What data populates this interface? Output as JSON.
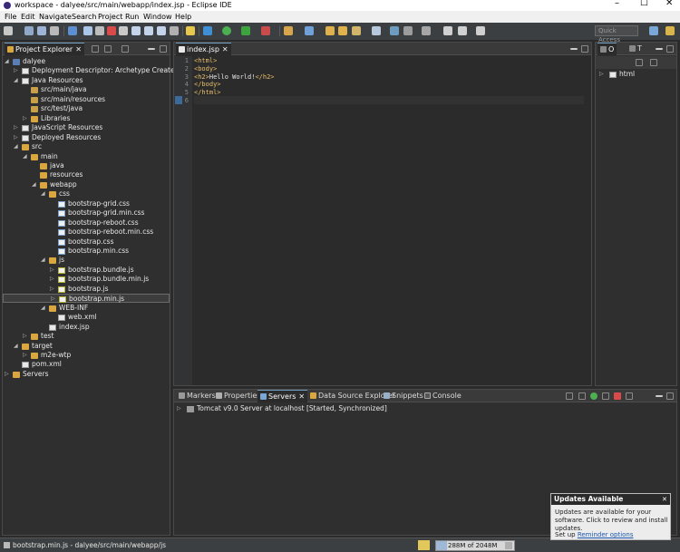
{
  "window": {
    "title": "workspace - dalyee/src/main/webapp/index.jsp - Eclipse IDE",
    "minimize": "–",
    "maximize": "☐",
    "close": "✕"
  },
  "menu": [
    "File",
    "Edit",
    "Navigate",
    "Search",
    "Project",
    "Run",
    "Window",
    "Help"
  ],
  "toolbar": {
    "quick_access_placeholder": "Quick Access"
  },
  "project_explorer": {
    "tab_label": "Project Explorer",
    "tree": [
      {
        "label": "dalyee",
        "depth": 0,
        "twisty": "open",
        "icon": "proj"
      },
      {
        "label": "Deployment Descriptor: Archetype Created Web",
        "depth": 1,
        "twisty": "closed",
        "icon": "file"
      },
      {
        "label": "Java Resources",
        "depth": 1,
        "twisty": "open",
        "icon": "file"
      },
      {
        "label": "src/main/java",
        "depth": 2,
        "twisty": "",
        "icon": "pkg"
      },
      {
        "label": "src/main/resources",
        "depth": 2,
        "twisty": "",
        "icon": "pkg"
      },
      {
        "label": "src/test/java",
        "depth": 2,
        "twisty": "",
        "icon": "pkg"
      },
      {
        "label": "Libraries",
        "depth": 2,
        "twisty": "closed",
        "icon": "folder"
      },
      {
        "label": "JavaScript Resources",
        "depth": 1,
        "twisty": "closed",
        "icon": "file"
      },
      {
        "label": "Deployed Resources",
        "depth": 1,
        "twisty": "closed",
        "icon": "file"
      },
      {
        "label": "src",
        "depth": 1,
        "twisty": "open",
        "icon": "folder"
      },
      {
        "label": "main",
        "depth": 2,
        "twisty": "open",
        "icon": "folder"
      },
      {
        "label": "java",
        "depth": 3,
        "twisty": "",
        "icon": "folder"
      },
      {
        "label": "resources",
        "depth": 3,
        "twisty": "",
        "icon": "folder"
      },
      {
        "label": "webapp",
        "depth": 3,
        "twisty": "open",
        "icon": "folder"
      },
      {
        "label": "css",
        "depth": 4,
        "twisty": "open",
        "icon": "folder"
      },
      {
        "label": "bootstrap-grid.css",
        "depth": 5,
        "twisty": "",
        "icon": "cssf"
      },
      {
        "label": "bootstrap-grid.min.css",
        "depth": 5,
        "twisty": "",
        "icon": "cssf"
      },
      {
        "label": "bootstrap-reboot.css",
        "depth": 5,
        "twisty": "",
        "icon": "cssf"
      },
      {
        "label": "bootstrap-reboot.min.css",
        "depth": 5,
        "twisty": "",
        "icon": "cssf"
      },
      {
        "label": "bootstrap.css",
        "depth": 5,
        "twisty": "",
        "icon": "cssf"
      },
      {
        "label": "bootstrap.min.css",
        "depth": 5,
        "twisty": "",
        "icon": "cssf"
      },
      {
        "label": "js",
        "depth": 4,
        "twisty": "open",
        "icon": "folder"
      },
      {
        "label": "bootstrap.bundle.js",
        "depth": 5,
        "twisty": "closed",
        "icon": "jsf"
      },
      {
        "label": "bootstrap.bundle.min.js",
        "depth": 5,
        "twisty": "closed",
        "icon": "jsf"
      },
      {
        "label": "bootstrap.js",
        "depth": 5,
        "twisty": "closed",
        "icon": "jsf"
      },
      {
        "label": "bootstrap.min.js",
        "depth": 5,
        "twisty": "closed",
        "icon": "jsf",
        "selected": true
      },
      {
        "label": "WEB-INF",
        "depth": 4,
        "twisty": "open",
        "icon": "folder"
      },
      {
        "label": "web.xml",
        "depth": 5,
        "twisty": "",
        "icon": "file"
      },
      {
        "label": "index.jsp",
        "depth": 4,
        "twisty": "",
        "icon": "file"
      },
      {
        "label": "test",
        "depth": 2,
        "twisty": "closed",
        "icon": "folder"
      },
      {
        "label": "target",
        "depth": 1,
        "twisty": "open",
        "icon": "folder"
      },
      {
        "label": "m2e-wtp",
        "depth": 2,
        "twisty": "closed",
        "icon": "folder"
      },
      {
        "label": "pom.xml",
        "depth": 1,
        "twisty": "",
        "icon": "file"
      },
      {
        "label": "Servers",
        "depth": 0,
        "twisty": "closed",
        "icon": "folder"
      }
    ]
  },
  "editor": {
    "tab_label": "index.jsp",
    "lines": [
      {
        "n": "1",
        "text": "<html>"
      },
      {
        "n": "2",
        "text": "<body>"
      },
      {
        "n": "3",
        "text": "<h2>Hello World!</h2>"
      },
      {
        "n": "4",
        "text": "</body>"
      },
      {
        "n": "5",
        "text": "</html>"
      },
      {
        "n": "6",
        "text": ""
      }
    ]
  },
  "outline": {
    "tab_o": "O",
    "tab_t": "T",
    "items": [
      "html"
    ]
  },
  "bottom_tabs": [
    "Markers",
    "Properties",
    "Servers",
    "Data Source Explorer",
    "Snippets",
    "Console"
  ],
  "servers": [
    {
      "label": "Tomcat v9.0 Server at localhost  [Started, Synchronized]"
    }
  ],
  "status": {
    "path": "bootstrap.min.js - dalyee/src/main/webapp/js",
    "heap": "288M of 2048M",
    "heap_fraction": 0.14
  },
  "updates_popup": {
    "title": "Updates Available",
    "body": "Updates are available for your software. Click to review and install updates.",
    "footer_prefix": "Set up ",
    "footer_link": "Reminder options"
  },
  "colors": {
    "accent": "#6d9cbe",
    "tag": "#e8bf6a",
    "background": "#2b2b2b"
  }
}
